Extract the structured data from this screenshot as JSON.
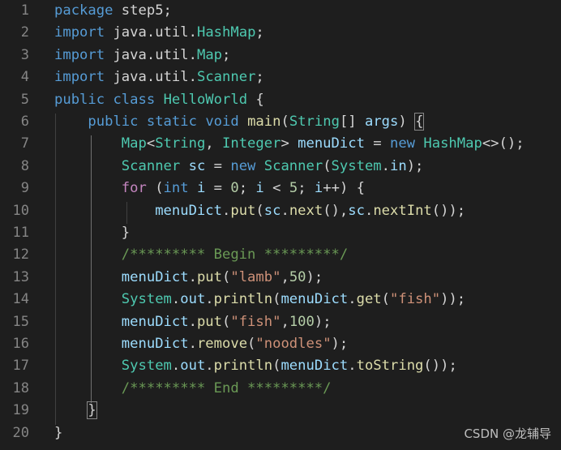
{
  "editor": {
    "lines": [
      {
        "n": "1",
        "tokens": [
          [
            "kw",
            "package"
          ],
          [
            "plain",
            " step5;"
          ]
        ]
      },
      {
        "n": "2",
        "tokens": [
          [
            "kw",
            "import"
          ],
          [
            "plain",
            " java.util.HashMap;"
          ]
        ]
      },
      {
        "n": "3",
        "tokens": [
          [
            "kw",
            "import"
          ],
          [
            "plain",
            " java.util.Map;"
          ]
        ]
      },
      {
        "n": "4",
        "tokens": [
          [
            "kw",
            "import"
          ],
          [
            "plain",
            " java.util.Scanner;"
          ]
        ]
      },
      {
        "n": "5",
        "tokens": [
          [
            "kw",
            "public"
          ],
          [
            "plain",
            " "
          ],
          [
            "kw",
            "class"
          ],
          [
            "plain",
            " HelloWorld {"
          ]
        ]
      },
      {
        "n": "6",
        "tokens": [
          [
            "plain",
            "    "
          ],
          [
            "kw",
            "public"
          ],
          [
            "plain",
            " "
          ],
          [
            "kw",
            "static"
          ],
          [
            "plain",
            " "
          ],
          [
            "kw",
            "void"
          ],
          [
            "plain",
            " main(String[] args) "
          ],
          [
            "brace",
            "{"
          ]
        ]
      },
      {
        "n": "7",
        "tokens": [
          [
            "plain",
            "        Map<String, Integer> menuDict = "
          ],
          [
            "kw",
            "new"
          ],
          [
            "plain",
            " HashMap<>();"
          ]
        ]
      },
      {
        "n": "8",
        "tokens": [
          [
            "plain",
            "        Scanner sc = "
          ],
          [
            "kw",
            "new"
          ],
          [
            "plain",
            " Scanner(System.in);"
          ]
        ]
      },
      {
        "n": "9",
        "tokens": [
          [
            "plain",
            "        "
          ],
          [
            "kw",
            "for"
          ],
          [
            "plain",
            " ("
          ],
          [
            "kw",
            "int"
          ],
          [
            "plain",
            " i = "
          ],
          [
            "plain",
            "0"
          ],
          [
            "plain",
            "; i < "
          ],
          [
            "plain",
            "5"
          ],
          [
            "plain",
            "; i++) {"
          ]
        ]
      },
      {
        "n": "10",
        "tokens": [
          [
            "plain",
            "            menuDict.put(sc.next(),sc.nextInt());"
          ]
        ]
      },
      {
        "n": "11",
        "tokens": [
          [
            "plain",
            "        }"
          ]
        ]
      },
      {
        "n": "12",
        "tokens": [
          [
            "plain",
            "        "
          ],
          [
            "cm",
            "/********* Begin *********/"
          ]
        ]
      },
      {
        "n": "13",
        "tokens": [
          [
            "plain",
            "        menuDict.put("
          ],
          [
            "str",
            "\"lamb\""
          ],
          [
            "plain",
            ",50);"
          ]
        ]
      },
      {
        "n": "14",
        "tokens": [
          [
            "plain",
            "        System.out.println(menuDict.get("
          ],
          [
            "str",
            "\"fish\""
          ],
          [
            "plain",
            "));"
          ]
        ]
      },
      {
        "n": "15",
        "tokens": [
          [
            "plain",
            "        menuDict.put("
          ],
          [
            "str",
            "\"fish\""
          ],
          [
            "plain",
            ",100);"
          ]
        ]
      },
      {
        "n": "16",
        "tokens": [
          [
            "plain",
            "        menuDict.remove("
          ],
          [
            "str",
            "\"noodles\""
          ],
          [
            "plain",
            ");"
          ]
        ]
      },
      {
        "n": "17",
        "tokens": [
          [
            "plain",
            "        System.out.println(menuDict.toString());"
          ]
        ]
      },
      {
        "n": "18",
        "tokens": [
          [
            "plain",
            "        "
          ],
          [
            "cm",
            "/********* End *********/"
          ]
        ]
      },
      {
        "n": "19",
        "tokens": [
          [
            "plain",
            "    "
          ],
          [
            "brace",
            "}"
          ]
        ]
      },
      {
        "n": "20",
        "tokens": [
          [
            "plain",
            "}"
          ]
        ]
      }
    ]
  },
  "watermark": "CSDN @龙辅导"
}
